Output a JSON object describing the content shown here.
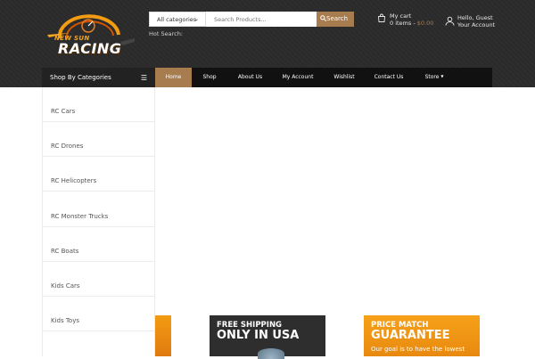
{
  "header": {
    "logo": {
      "line1": "NEW SUN",
      "line2a": "RAC",
      "line2b": "ING"
    },
    "search": {
      "category_label": "All categories",
      "placeholder": "Search Products...",
      "button_label": "Search",
      "hot_search_label": "Hot Search:"
    },
    "cart": {
      "title": "My cart",
      "items_label": "0 items - ",
      "amount": "$0.00"
    },
    "account": {
      "greeting": "Hello, Guest",
      "link": "Your Account"
    }
  },
  "nav": {
    "shop_by": "Shop By Categories",
    "items": [
      {
        "label": "Home",
        "active": true
      },
      {
        "label": "Shop"
      },
      {
        "label": "About Us"
      },
      {
        "label": "My Account"
      },
      {
        "label": "Wishlist"
      },
      {
        "label": "Contact Us"
      },
      {
        "label": "Store"
      }
    ]
  },
  "sidebar": {
    "categories": [
      "RC Cars",
      "RC Drones",
      "RC Helicopters",
      "RC Monster Trucks",
      "RC Boats",
      "Kids Cars",
      "Kids Toys"
    ]
  },
  "banners": {
    "shipping": {
      "line1": "FREE SHIPPING",
      "line2": "ONLY IN USA"
    },
    "price": {
      "line1": "PRICE MATCH",
      "line2": "GUARANTEE",
      "sub": "Our goal is to have the lowest"
    }
  },
  "colors": {
    "accent": "#a77c4f",
    "header_bg": "#2b2b2b",
    "nav_bg": "#111111"
  }
}
